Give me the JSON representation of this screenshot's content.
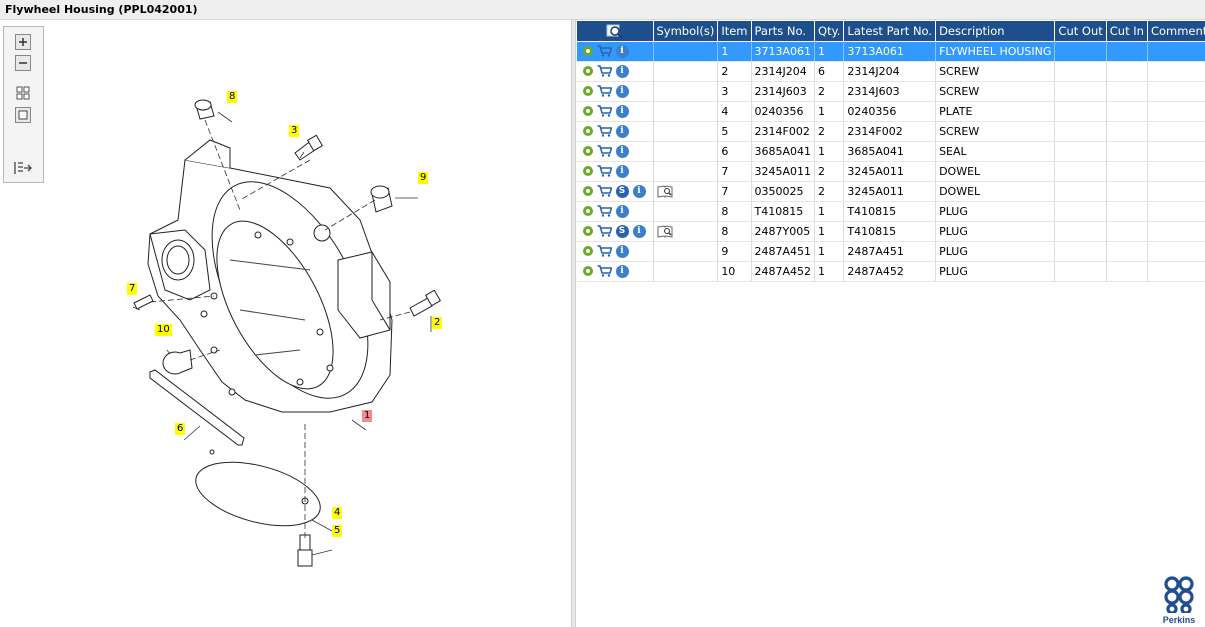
{
  "title": "Flywheel Housing (PPL042001)",
  "toolbar": {
    "icons": [
      "zoom-in-icon",
      "zoom-out-icon",
      "fit-all-icon",
      "fit-window-icon",
      "show-list-icon"
    ]
  },
  "callouts": {
    "c1": "1",
    "c2": "2",
    "c3": "3",
    "c4": "4",
    "c5": "5",
    "c6": "6",
    "c7": "7",
    "c8": "8",
    "c9": "9",
    "c10": "10"
  },
  "table": {
    "columns": [
      "Symbol(s)",
      "Item",
      "Parts No.",
      "Qty.",
      "Latest Part No.",
      "Description",
      "Cut Out",
      "Cut In",
      "Comment"
    ],
    "rows": [
      {
        "item": "1",
        "parts_no": "3713A061",
        "qty": "1",
        "latest": "3713A061",
        "desc": "FLYWHEEL HOUSING",
        "sym": false,
        "book": false
      },
      {
        "item": "2",
        "parts_no": "2314J204",
        "qty": "6",
        "latest": "2314J204",
        "desc": "SCREW",
        "sym": false,
        "book": false
      },
      {
        "item": "3",
        "parts_no": "2314J603",
        "qty": "2",
        "latest": "2314J603",
        "desc": "SCREW",
        "sym": false,
        "book": false
      },
      {
        "item": "4",
        "parts_no": "0240356",
        "qty": "1",
        "latest": "0240356",
        "desc": "PLATE",
        "sym": false,
        "book": false
      },
      {
        "item": "5",
        "parts_no": "2314F002",
        "qty": "2",
        "latest": "2314F002",
        "desc": "SCREW",
        "sym": false,
        "book": false
      },
      {
        "item": "6",
        "parts_no": "3685A041",
        "qty": "1",
        "latest": "3685A041",
        "desc": "SEAL",
        "sym": false,
        "book": false
      },
      {
        "item": "7",
        "parts_no": "3245A011",
        "qty": "2",
        "latest": "3245A011",
        "desc": "DOWEL",
        "sym": false,
        "book": false
      },
      {
        "item": "7",
        "parts_no": "0350025",
        "qty": "2",
        "latest": "3245A011",
        "desc": "DOWEL",
        "sym": true,
        "book": true
      },
      {
        "item": "8",
        "parts_no": "T410815",
        "qty": "1",
        "latest": "T410815",
        "desc": "PLUG",
        "sym": false,
        "book": false
      },
      {
        "item": "8",
        "parts_no": "2487Y005",
        "qty": "1",
        "latest": "T410815",
        "desc": "PLUG",
        "sym": true,
        "book": true
      },
      {
        "item": "9",
        "parts_no": "2487A451",
        "qty": "1",
        "latest": "2487A451",
        "desc": "PLUG",
        "sym": false,
        "book": false
      },
      {
        "item": "10",
        "parts_no": "2487A452",
        "qty": "1",
        "latest": "2487A452",
        "desc": "PLUG",
        "sym": false,
        "book": false
      }
    ],
    "selected_row": 0
  },
  "logo": {
    "text": "Perkins"
  },
  "colors": {
    "header": "#1c4f8c",
    "selected": "#3399ff",
    "callout": "#ffff00",
    "callout_selected": "#f28b8b",
    "gear": "#6aaa2a",
    "info": "#3d7fc9"
  }
}
